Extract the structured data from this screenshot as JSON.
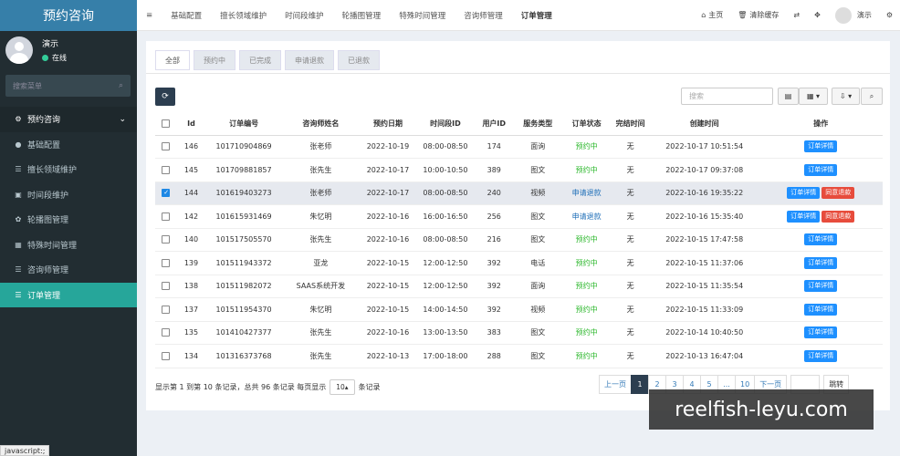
{
  "app": {
    "title": "预约咨询"
  },
  "user": {
    "name": "演示",
    "status": "在线"
  },
  "sidebar": {
    "search_placeholder": "搜索菜单",
    "items": [
      {
        "label": "预约咨询",
        "icon": "wrench-icon"
      },
      {
        "label": "基础配置",
        "icon": "pin-icon"
      },
      {
        "label": "擅长领域维护",
        "icon": "list-icon"
      },
      {
        "label": "时间段维护",
        "icon": "image-icon"
      },
      {
        "label": "轮播图管理",
        "icon": "gear-icon"
      },
      {
        "label": "特殊时间管理",
        "icon": "calendar-icon"
      },
      {
        "label": "咨询师管理",
        "icon": "list-icon"
      },
      {
        "label": "订单管理",
        "icon": "list-icon"
      }
    ]
  },
  "topbar": {
    "tabs": [
      "基础配置",
      "擅长领域维护",
      "时间段维护",
      "轮播图管理",
      "特殊时间管理",
      "咨询师管理",
      "订单管理"
    ],
    "home": "主页",
    "clear_cache": "清除缓存",
    "user": "演示"
  },
  "filter_tabs": [
    "全部",
    "预约中",
    "已完成",
    "申请退款",
    "已退款"
  ],
  "search": {
    "placeholder": "搜索"
  },
  "table": {
    "headers": [
      "Id",
      "订单编号",
      "咨询师姓名",
      "预约日期",
      "时间段ID",
      "用户ID",
      "服务类型",
      "订单状态",
      "完结时间",
      "创建时间",
      "操作"
    ],
    "rows": [
      {
        "id": "146",
        "order_no": "101710904869",
        "counselor": "张老师",
        "date": "2022-10-19",
        "slot": "08:00-08:50",
        "user_id": "174",
        "service": "面询",
        "status": "预约中",
        "done": "无",
        "created": "2022-10-17 10:51:54",
        "refund": false,
        "checked": false
      },
      {
        "id": "145",
        "order_no": "101709881857",
        "counselor": "张先生",
        "date": "2022-10-17",
        "slot": "10:00-10:50",
        "user_id": "389",
        "service": "图文",
        "status": "预约中",
        "done": "无",
        "created": "2022-10-17 09:37:08",
        "refund": false,
        "checked": false
      },
      {
        "id": "144",
        "order_no": "101619403273",
        "counselor": "张老师",
        "date": "2022-10-17",
        "slot": "08:00-08:50",
        "user_id": "240",
        "service": "视频",
        "status": "申请退款",
        "done": "无",
        "created": "2022-10-16 19:35:22",
        "refund": true,
        "checked": true
      },
      {
        "id": "142",
        "order_no": "101615931469",
        "counselor": "朱忆明",
        "date": "2022-10-16",
        "slot": "16:00-16:50",
        "user_id": "256",
        "service": "图文",
        "status": "申请退款",
        "done": "无",
        "created": "2022-10-16 15:35:40",
        "refund": true,
        "checked": false
      },
      {
        "id": "140",
        "order_no": "101517505570",
        "counselor": "张先生",
        "date": "2022-10-16",
        "slot": "08:00-08:50",
        "user_id": "216",
        "service": "图文",
        "status": "预约中",
        "done": "无",
        "created": "2022-10-15 17:47:58",
        "refund": false,
        "checked": false
      },
      {
        "id": "139",
        "order_no": "101511943372",
        "counselor": "亚龙",
        "date": "2022-10-15",
        "slot": "12:00-12:50",
        "user_id": "392",
        "service": "电话",
        "status": "预约中",
        "done": "无",
        "created": "2022-10-15 11:37:06",
        "refund": false,
        "checked": false
      },
      {
        "id": "138",
        "order_no": "101511982072",
        "counselor": "SAAS系统开发",
        "date": "2022-10-15",
        "slot": "12:00-12:50",
        "user_id": "392",
        "service": "面询",
        "status": "预约中",
        "done": "无",
        "created": "2022-10-15 11:35:54",
        "refund": false,
        "checked": false
      },
      {
        "id": "137",
        "order_no": "101511954370",
        "counselor": "朱忆明",
        "date": "2022-10-15",
        "slot": "14:00-14:50",
        "user_id": "392",
        "service": "视频",
        "status": "预约中",
        "done": "无",
        "created": "2022-10-15 11:33:09",
        "refund": false,
        "checked": false
      },
      {
        "id": "135",
        "order_no": "101410427377",
        "counselor": "张先生",
        "date": "2022-10-16",
        "slot": "13:00-13:50",
        "user_id": "383",
        "service": "图文",
        "status": "预约中",
        "done": "无",
        "created": "2022-10-14 10:40:50",
        "refund": false,
        "checked": false
      },
      {
        "id": "134",
        "order_no": "101316373768",
        "counselor": "张先生",
        "date": "2022-10-13",
        "slot": "17:00-18:00",
        "user_id": "288",
        "service": "图文",
        "status": "预约中",
        "done": "无",
        "created": "2022-10-13 16:47:04",
        "refund": false,
        "checked": false
      }
    ],
    "detail_label": "订单详情",
    "refund_label": "同意退款"
  },
  "footer": {
    "info_prefix": "显示第 1 到第 10 条记录，总共 96 条记录 每页显示",
    "page_size": "10",
    "info_suffix": "条记录"
  },
  "pager": {
    "prev": "上一页",
    "pages": [
      "1",
      "2",
      "3",
      "4",
      "5",
      "...",
      "10"
    ],
    "next": "下一页",
    "goto": "跳转"
  },
  "watermark": "reelfish-leyu.com",
  "statusbar": "javascript:;"
}
